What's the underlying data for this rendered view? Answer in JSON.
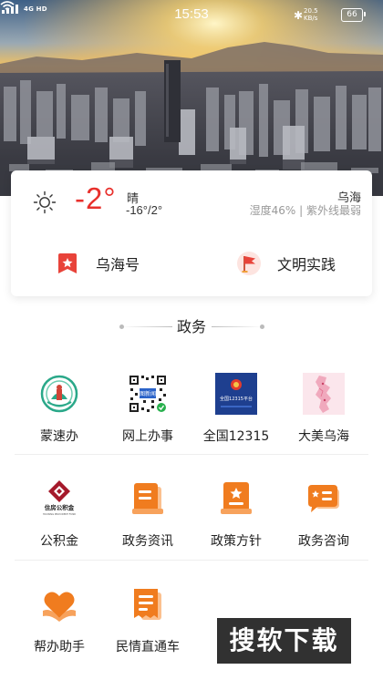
{
  "status_bar": {
    "network": "4G HD",
    "time": "15:53",
    "speed_value": "20.5",
    "speed_unit": "KB/s",
    "battery": "66"
  },
  "weather": {
    "icon": "sun-icon",
    "temperature": "-2°",
    "condition": "晴",
    "range": "-16°/2°",
    "city": "乌海",
    "details": "湿度46% | 紫外线最弱",
    "temp_color": "#e8302c"
  },
  "quick_links": [
    {
      "label": "乌海号",
      "icon": "bookmark-icon"
    },
    {
      "label": "文明实践",
      "icon": "flag-icon"
    }
  ],
  "section": {
    "title": "政务"
  },
  "services": [
    {
      "label": "蒙速办",
      "icon": "mengsuban-logo-icon"
    },
    {
      "label": "网上办事",
      "icon": "qr-code-icon"
    },
    {
      "label": "全国12315",
      "icon": "national-12315-icon"
    },
    {
      "label": "大美乌海",
      "icon": "map-icon"
    },
    {
      "label": "公积金",
      "icon": "housing-fund-logo-icon"
    },
    {
      "label": "政务资讯",
      "icon": "news-document-icon"
    },
    {
      "label": "政策方针",
      "icon": "policy-star-icon"
    },
    {
      "label": "政务咨询",
      "icon": "consult-chat-icon"
    },
    {
      "label": "帮办助手",
      "icon": "heart-hands-icon"
    },
    {
      "label": "民情直通车",
      "icon": "receipt-icon"
    }
  ],
  "logo_text": {
    "housing_fund_cn": "住房公积金",
    "housing_fund_en": "HOUSING PROVIDENT FUND",
    "qr_badge": "图新闻",
    "national_badge": "全国12315平台"
  },
  "watermark": "搜软下载",
  "colors": {
    "accent_orange": "#f07c1f",
    "accent_red": "#e8302c"
  }
}
